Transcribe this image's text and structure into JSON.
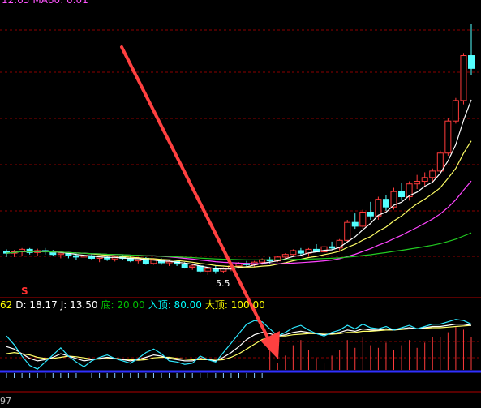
{
  "top_legend": [
    {
      "label": "12.65",
      "color": "#ff55ff"
    },
    {
      "label": "MA60: 0.01",
      "color": "#ff55ff"
    }
  ],
  "indicator_legend": [
    {
      "label": "62",
      "color": "#ffff00"
    },
    {
      "label": "D: 18.17",
      "color": "#ffffff"
    },
    {
      "label": "J: 13.50",
      "color": "#ffffff"
    },
    {
      "label": "底: 20.00",
      "color": "#00c000"
    },
    {
      "label": "入顶: 80.00",
      "color": "#00ffff"
    },
    {
      "label": "大顶: 100.00",
      "color": "#ffff00"
    }
  ],
  "low_price_label": "5.5",
  "signal_label": "S",
  "bottom_label": "97",
  "colors": {
    "up": "#ff3b3b",
    "down": "#54ffff",
    "grid": "#8b0000",
    "ma_white": "#ffffff",
    "ma_yellow": "#ffff66",
    "ma_magenta": "#ff44ff",
    "ma_green": "#22cc22",
    "arrow": "#ff4040",
    "base_line": "#3030ff"
  },
  "chart_data": {
    "type": "candlestick",
    "candles": [
      {
        "o": 5.81,
        "h": 5.84,
        "l": 5.72,
        "c": 5.78
      },
      {
        "o": 5.78,
        "h": 5.83,
        "l": 5.72,
        "c": 5.8
      },
      {
        "o": 5.8,
        "h": 5.86,
        "l": 5.74,
        "c": 5.84
      },
      {
        "o": 5.84,
        "h": 5.86,
        "l": 5.76,
        "c": 5.79
      },
      {
        "o": 5.79,
        "h": 5.85,
        "l": 5.74,
        "c": 5.82
      },
      {
        "o": 5.82,
        "h": 5.86,
        "l": 5.76,
        "c": 5.8
      },
      {
        "o": 5.8,
        "h": 5.83,
        "l": 5.73,
        "c": 5.76
      },
      {
        "o": 5.76,
        "h": 5.8,
        "l": 5.7,
        "c": 5.78
      },
      {
        "o": 5.78,
        "h": 5.8,
        "l": 5.7,
        "c": 5.74
      },
      {
        "o": 5.74,
        "h": 5.78,
        "l": 5.68,
        "c": 5.72
      },
      {
        "o": 5.72,
        "h": 5.76,
        "l": 5.66,
        "c": 5.74
      },
      {
        "o": 5.74,
        "h": 5.78,
        "l": 5.68,
        "c": 5.7
      },
      {
        "o": 5.7,
        "h": 5.74,
        "l": 5.64,
        "c": 5.72
      },
      {
        "o": 5.72,
        "h": 5.75,
        "l": 5.66,
        "c": 5.69
      },
      {
        "o": 5.69,
        "h": 5.74,
        "l": 5.65,
        "c": 5.72
      },
      {
        "o": 5.72,
        "h": 5.76,
        "l": 5.67,
        "c": 5.7
      },
      {
        "o": 5.7,
        "h": 5.74,
        "l": 5.64,
        "c": 5.66
      },
      {
        "o": 5.66,
        "h": 5.72,
        "l": 5.62,
        "c": 5.7
      },
      {
        "o": 5.7,
        "h": 5.72,
        "l": 5.6,
        "c": 5.62
      },
      {
        "o": 5.62,
        "h": 5.7,
        "l": 5.6,
        "c": 5.68
      },
      {
        "o": 5.68,
        "h": 5.7,
        "l": 5.6,
        "c": 5.63
      },
      {
        "o": 5.63,
        "h": 5.68,
        "l": 5.58,
        "c": 5.65
      },
      {
        "o": 5.65,
        "h": 5.68,
        "l": 5.58,
        "c": 5.61
      },
      {
        "o": 5.61,
        "h": 5.64,
        "l": 5.54,
        "c": 5.56
      },
      {
        "o": 5.56,
        "h": 5.62,
        "l": 5.52,
        "c": 5.58
      },
      {
        "o": 5.58,
        "h": 5.6,
        "l": 5.48,
        "c": 5.5
      },
      {
        "o": 5.5,
        "h": 5.56,
        "l": 5.44,
        "c": 5.54
      },
      {
        "o": 5.54,
        "h": 5.58,
        "l": 5.46,
        "c": 5.5
      },
      {
        "o": 5.5,
        "h": 5.56,
        "l": 5.47,
        "c": 5.54
      },
      {
        "o": 5.54,
        "h": 5.6,
        "l": 5.5,
        "c": 5.58
      },
      {
        "o": 5.58,
        "h": 5.64,
        "l": 5.54,
        "c": 5.62
      },
      {
        "o": 5.62,
        "h": 5.66,
        "l": 5.56,
        "c": 5.6
      },
      {
        "o": 5.6,
        "h": 5.66,
        "l": 5.56,
        "c": 5.64
      },
      {
        "o": 5.64,
        "h": 5.7,
        "l": 5.6,
        "c": 5.68
      },
      {
        "o": 5.68,
        "h": 5.72,
        "l": 5.62,
        "c": 5.66
      },
      {
        "o": 5.66,
        "h": 5.74,
        "l": 5.64,
        "c": 5.72
      },
      {
        "o": 5.72,
        "h": 5.78,
        "l": 5.68,
        "c": 5.76
      },
      {
        "o": 5.76,
        "h": 5.84,
        "l": 5.72,
        "c": 5.82
      },
      {
        "o": 5.82,
        "h": 5.86,
        "l": 5.74,
        "c": 5.78
      },
      {
        "o": 5.78,
        "h": 5.86,
        "l": 5.74,
        "c": 5.84
      },
      {
        "o": 5.84,
        "h": 5.92,
        "l": 5.8,
        "c": 5.8
      },
      {
        "o": 5.8,
        "h": 5.9,
        "l": 5.76,
        "c": 5.88
      },
      {
        "o": 5.88,
        "h": 5.96,
        "l": 5.84,
        "c": 5.86
      },
      {
        "o": 5.86,
        "h": 6.0,
        "l": 5.82,
        "c": 5.98
      },
      {
        "o": 5.98,
        "h": 6.3,
        "l": 5.96,
        "c": 6.26
      },
      {
        "o": 6.26,
        "h": 6.4,
        "l": 6.16,
        "c": 6.2
      },
      {
        "o": 6.2,
        "h": 6.46,
        "l": 6.16,
        "c": 6.42
      },
      {
        "o": 6.42,
        "h": 6.58,
        "l": 6.3,
        "c": 6.36
      },
      {
        "o": 6.36,
        "h": 6.66,
        "l": 6.3,
        "c": 6.62
      },
      {
        "o": 6.62,
        "h": 6.68,
        "l": 6.44,
        "c": 6.5
      },
      {
        "o": 6.5,
        "h": 6.8,
        "l": 6.46,
        "c": 6.74
      },
      {
        "o": 6.74,
        "h": 6.88,
        "l": 6.6,
        "c": 6.66
      },
      {
        "o": 6.66,
        "h": 6.9,
        "l": 6.6,
        "c": 6.86
      },
      {
        "o": 6.86,
        "h": 7.0,
        "l": 6.78,
        "c": 6.9
      },
      {
        "o": 6.9,
        "h": 7.04,
        "l": 6.82,
        "c": 6.96
      },
      {
        "o": 6.96,
        "h": 7.1,
        "l": 6.9,
        "c": 7.06
      },
      {
        "o": 7.06,
        "h": 7.38,
        "l": 7.02,
        "c": 7.34
      },
      {
        "o": 7.34,
        "h": 7.88,
        "l": 7.3,
        "c": 7.84
      },
      {
        "o": 7.84,
        "h": 8.2,
        "l": 7.8,
        "c": 8.16
      },
      {
        "o": 8.16,
        "h": 8.9,
        "l": 8.1,
        "c": 8.86
      },
      {
        "o": 8.86,
        "h": 9.36,
        "l": 8.56,
        "c": 8.66
      }
    ],
    "kdj": {
      "k": [
        42,
        38,
        30,
        22,
        18,
        20,
        24,
        30,
        26,
        22,
        18,
        20,
        22,
        24,
        22,
        20,
        18,
        20,
        24,
        28,
        26,
        22,
        20,
        18,
        18,
        22,
        20,
        18,
        24,
        32,
        42,
        54,
        62,
        66,
        64,
        60,
        62,
        66,
        68,
        66,
        64,
        62,
        64,
        66,
        70,
        68,
        72,
        70,
        70,
        72,
        70,
        72,
        74,
        72,
        74,
        76,
        76,
        78,
        80,
        80,
        78
      ],
      "d": [
        30,
        32,
        30,
        28,
        24,
        22,
        22,
        24,
        26,
        25,
        23,
        21,
        21,
        22,
        22,
        21,
        20,
        19,
        20,
        23,
        24,
        24,
        22,
        21,
        20,
        20,
        20,
        19,
        20,
        24,
        30,
        38,
        46,
        54,
        58,
        60,
        60,
        62,
        63,
        64,
        64,
        63,
        63,
        64,
        66,
        66,
        68,
        68,
        69,
        70,
        70,
        71,
        72,
        72,
        73,
        74,
        74,
        75,
        76,
        77,
        78
      ],
      "j": [
        60,
        45,
        26,
        10,
        4,
        16,
        28,
        40,
        26,
        16,
        8,
        18,
        24,
        28,
        22,
        18,
        14,
        22,
        32,
        38,
        30,
        18,
        16,
        12,
        14,
        26,
        20,
        16,
        32,
        48,
        64,
        80,
        86,
        84,
        72,
        60,
        66,
        74,
        78,
        70,
        64,
        60,
        66,
        70,
        78,
        72,
        80,
        74,
        72,
        76,
        70,
        74,
        78,
        72,
        76,
        80,
        80,
        84,
        88,
        86,
        80
      ]
    }
  }
}
